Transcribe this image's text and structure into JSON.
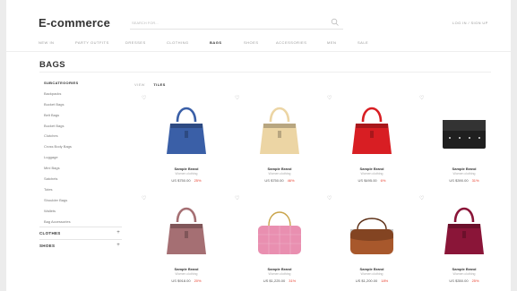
{
  "header": {
    "logo": "E-commerce",
    "search_placeholder": "SEARCH FOR...",
    "login": "LOG IN / SIGN UP"
  },
  "nav": [
    {
      "label": "NEW IN",
      "active": false
    },
    {
      "label": "PARTY OUTFITS",
      "active": false
    },
    {
      "label": "DRESSES",
      "active": false
    },
    {
      "label": "CLOTHING",
      "active": false
    },
    {
      "label": "BAGS",
      "active": true
    },
    {
      "label": "SHOES",
      "active": false
    },
    {
      "label": "ACCESSORIES",
      "active": false
    },
    {
      "label": "MEN",
      "active": false
    },
    {
      "label": "SALE",
      "active": false
    }
  ],
  "page_title": "BAGS",
  "sidebar": {
    "categories": [
      "SUBCATEGORIES",
      "Backpacks",
      "Bucket Bags",
      "Belt Bags",
      "Bucket Bags",
      "Clutches",
      "Cross Body Bags",
      "Luggage",
      "Mini Bags",
      "Satchels",
      "Totes",
      "Shoulder Bags",
      "Wallets",
      "Bag Accessories"
    ],
    "sections": [
      "CLOTHES",
      "SHOES"
    ]
  },
  "view": {
    "label": "VIEW",
    "option": "TILES"
  },
  "products": [
    {
      "name": "Sample Brand",
      "subtitle": "Women clothing",
      "price": "US $750.00",
      "discount": "25%",
      "color": "#3a5fa7",
      "shape": "tote"
    },
    {
      "name": "Sample Brand",
      "subtitle": "Women clothing",
      "price": "US $750.00",
      "discount": "46%",
      "color": "#ecd5a4",
      "shape": "tote"
    },
    {
      "name": "Sample Brand",
      "subtitle": "Women clothing",
      "price": "US $495.00",
      "discount": "6%",
      "color": "#d81e23",
      "shape": "tote"
    },
    {
      "name": "Sample Brand",
      "subtitle": "Women clothing",
      "price": "US $390.00",
      "discount": "31%",
      "color": "#1f1f1f",
      "shape": "clutch"
    },
    {
      "name": "Sample Brand",
      "subtitle": "Women clothing",
      "price": "US $918.00",
      "discount": "20%",
      "color": "#a56f73",
      "shape": "tote"
    },
    {
      "name": "Sample Brand",
      "subtitle": "Women clothing",
      "price": "US $1,225.00",
      "discount": "31%",
      "color": "#e98fb0",
      "shape": "quilted"
    },
    {
      "name": "Sample Brand",
      "subtitle": "Women clothing",
      "price": "US $1,200.00",
      "discount": "18%",
      "color": "#a8582c",
      "shape": "crossbody"
    },
    {
      "name": "Sample Brand",
      "subtitle": "Women clothing",
      "price": "US $350.00",
      "discount": "25%",
      "color": "#8a1538",
      "shape": "tote"
    }
  ]
}
